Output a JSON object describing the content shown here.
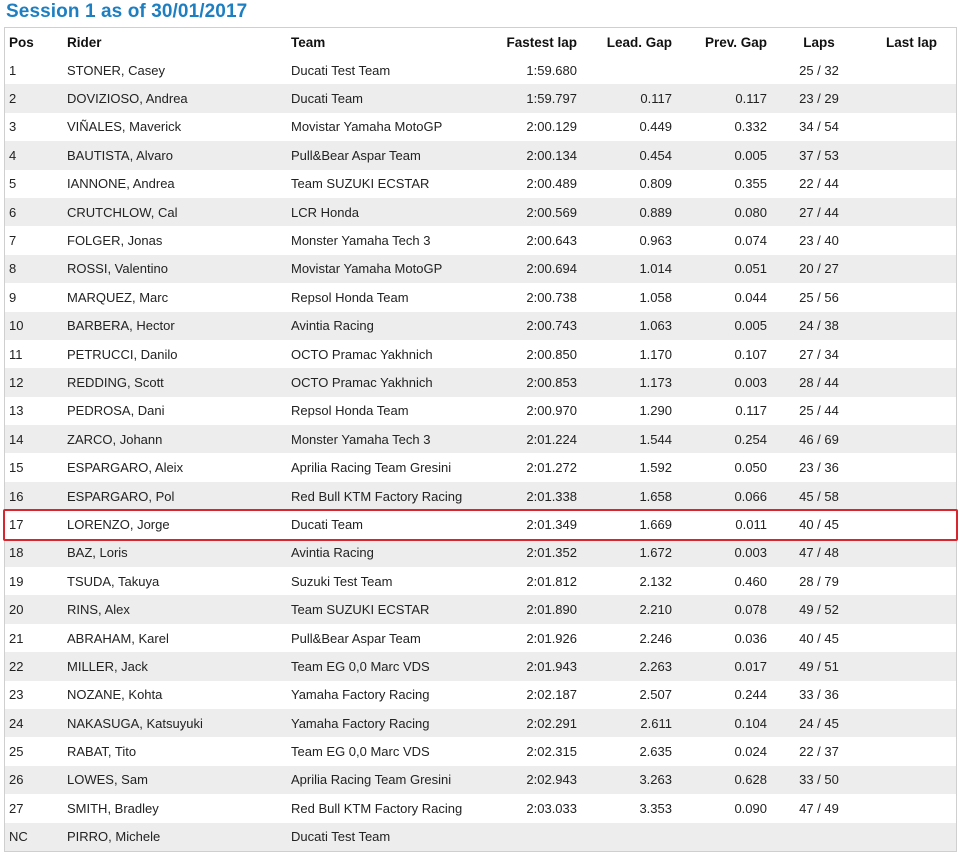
{
  "title": "Session 1 as of 30/01/2017",
  "columns": {
    "pos": "Pos",
    "rider": "Rider",
    "team": "Team",
    "fastest": "Fastest lap",
    "lead": "Lead. Gap",
    "prev": "Prev. Gap",
    "laps": "Laps",
    "last": "Last lap"
  },
  "highlight_color": "#d9262e",
  "accent_color": "#1d7fc1",
  "highlighted_pos": "17",
  "rows": [
    {
      "pos": "1",
      "rider": "STONER, Casey",
      "team": "Ducati Test Team",
      "fastest": "1:59.680",
      "lead": "",
      "prev": "",
      "laps": "25 / 32",
      "last": ""
    },
    {
      "pos": "2",
      "rider": "DOVIZIOSO, Andrea",
      "team": "Ducati Team",
      "fastest": "1:59.797",
      "lead": "0.117",
      "prev": "0.117",
      "laps": "23 / 29",
      "last": ""
    },
    {
      "pos": "3",
      "rider": "VIÑALES, Maverick",
      "team": "Movistar Yamaha MotoGP",
      "fastest": "2:00.129",
      "lead": "0.449",
      "prev": "0.332",
      "laps": "34 / 54",
      "last": ""
    },
    {
      "pos": "4",
      "rider": "BAUTISTA, Alvaro",
      "team": "Pull&Bear Aspar Team",
      "fastest": "2:00.134",
      "lead": "0.454",
      "prev": "0.005",
      "laps": "37 / 53",
      "last": ""
    },
    {
      "pos": "5",
      "rider": "IANNONE, Andrea",
      "team": "Team SUZUKI ECSTAR",
      "fastest": "2:00.489",
      "lead": "0.809",
      "prev": "0.355",
      "laps": "22 / 44",
      "last": ""
    },
    {
      "pos": "6",
      "rider": "CRUTCHLOW, Cal",
      "team": "LCR Honda",
      "fastest": "2:00.569",
      "lead": "0.889",
      "prev": "0.080",
      "laps": "27 / 44",
      "last": ""
    },
    {
      "pos": "7",
      "rider": "FOLGER, Jonas",
      "team": "Monster Yamaha Tech 3",
      "fastest": "2:00.643",
      "lead": "0.963",
      "prev": "0.074",
      "laps": "23 / 40",
      "last": ""
    },
    {
      "pos": "8",
      "rider": "ROSSI, Valentino",
      "team": "Movistar Yamaha MotoGP",
      "fastest": "2:00.694",
      "lead": "1.014",
      "prev": "0.051",
      "laps": "20 / 27",
      "last": ""
    },
    {
      "pos": "9",
      "rider": "MARQUEZ, Marc",
      "team": "Repsol Honda Team",
      "fastest": "2:00.738",
      "lead": "1.058",
      "prev": "0.044",
      "laps": "25 / 56",
      "last": ""
    },
    {
      "pos": "10",
      "rider": "BARBERA, Hector",
      "team": "Avintia Racing",
      "fastest": "2:00.743",
      "lead": "1.063",
      "prev": "0.005",
      "laps": "24 / 38",
      "last": ""
    },
    {
      "pos": "11",
      "rider": "PETRUCCI, Danilo",
      "team": "OCTO Pramac Yakhnich",
      "fastest": "2:00.850",
      "lead": "1.170",
      "prev": "0.107",
      "laps": "27 / 34",
      "last": ""
    },
    {
      "pos": "12",
      "rider": "REDDING, Scott",
      "team": "OCTO Pramac Yakhnich",
      "fastest": "2:00.853",
      "lead": "1.173",
      "prev": "0.003",
      "laps": "28 / 44",
      "last": ""
    },
    {
      "pos": "13",
      "rider": "PEDROSA, Dani",
      "team": "Repsol Honda Team",
      "fastest": "2:00.970",
      "lead": "1.290",
      "prev": "0.117",
      "laps": "25 / 44",
      "last": ""
    },
    {
      "pos": "14",
      "rider": "ZARCO, Johann",
      "team": "Monster Yamaha Tech 3",
      "fastest": "2:01.224",
      "lead": "1.544",
      "prev": "0.254",
      "laps": "46 / 69",
      "last": ""
    },
    {
      "pos": "15",
      "rider": "ESPARGARO, Aleix",
      "team": "Aprilia Racing Team Gresini",
      "fastest": "2:01.272",
      "lead": "1.592",
      "prev": "0.050",
      "laps": "23 / 36",
      "last": ""
    },
    {
      "pos": "16",
      "rider": "ESPARGARO, Pol",
      "team": "Red Bull KTM Factory Racing",
      "fastest": "2:01.338",
      "lead": "1.658",
      "prev": "0.066",
      "laps": "45 / 58",
      "last": ""
    },
    {
      "pos": "17",
      "rider": "LORENZO, Jorge",
      "team": "Ducati Team",
      "fastest": "2:01.349",
      "lead": "1.669",
      "prev": "0.011",
      "laps": "40 / 45",
      "last": ""
    },
    {
      "pos": "18",
      "rider": "BAZ, Loris",
      "team": "Avintia Racing",
      "fastest": "2:01.352",
      "lead": "1.672",
      "prev": "0.003",
      "laps": "47 / 48",
      "last": ""
    },
    {
      "pos": "19",
      "rider": "TSUDA, Takuya",
      "team": "Suzuki Test Team",
      "fastest": "2:01.812",
      "lead": "2.132",
      "prev": "0.460",
      "laps": "28 / 79",
      "last": ""
    },
    {
      "pos": "20",
      "rider": "RINS, Alex",
      "team": "Team SUZUKI ECSTAR",
      "fastest": "2:01.890",
      "lead": "2.210",
      "prev": "0.078",
      "laps": "49 / 52",
      "last": ""
    },
    {
      "pos": "21",
      "rider": "ABRAHAM, Karel",
      "team": "Pull&Bear Aspar Team",
      "fastest": "2:01.926",
      "lead": "2.246",
      "prev": "0.036",
      "laps": "40 / 45",
      "last": ""
    },
    {
      "pos": "22",
      "rider": "MILLER, Jack",
      "team": "Team EG 0,0 Marc VDS",
      "fastest": "2:01.943",
      "lead": "2.263",
      "prev": "0.017",
      "laps": "49 / 51",
      "last": ""
    },
    {
      "pos": "23",
      "rider": "NOZANE, Kohta",
      "team": "Yamaha Factory Racing",
      "fastest": "2:02.187",
      "lead": "2.507",
      "prev": "0.244",
      "laps": "33 / 36",
      "last": ""
    },
    {
      "pos": "24",
      "rider": "NAKASUGA, Katsuyuki",
      "team": "Yamaha Factory Racing",
      "fastest": "2:02.291",
      "lead": "2.611",
      "prev": "0.104",
      "laps": "24 / 45",
      "last": ""
    },
    {
      "pos": "25",
      "rider": "RABAT, Tito",
      "team": "Team EG 0,0 Marc VDS",
      "fastest": "2:02.315",
      "lead": "2.635",
      "prev": "0.024",
      "laps": "22 / 37",
      "last": ""
    },
    {
      "pos": "26",
      "rider": "LOWES, Sam",
      "team": "Aprilia Racing Team Gresini",
      "fastest": "2:02.943",
      "lead": "3.263",
      "prev": "0.628",
      "laps": "33 / 50",
      "last": ""
    },
    {
      "pos": "27",
      "rider": "SMITH, Bradley",
      "team": "Red Bull KTM Factory Racing",
      "fastest": "2:03.033",
      "lead": "3.353",
      "prev": "0.090",
      "laps": "47 / 49",
      "last": ""
    },
    {
      "pos": "NC",
      "rider": "PIRRO, Michele",
      "team": "Ducati Test Team",
      "fastest": "",
      "lead": "",
      "prev": "",
      "laps": "",
      "last": ""
    }
  ]
}
